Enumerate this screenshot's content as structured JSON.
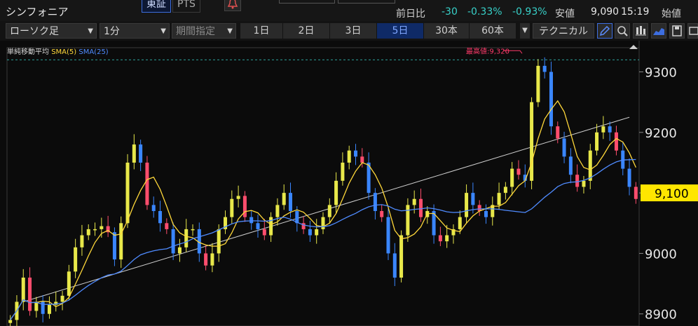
{
  "header": {
    "title": "シンフォニア",
    "exchange_tabs": [
      {
        "label": "東証",
        "active": true
      },
      {
        "label": "PTS",
        "active": false
      }
    ],
    "bell_icon": "bell-icon"
  },
  "quote": {
    "prev_label": "前日比",
    "change": "-30",
    "change_pct": "-0.33%",
    "change_pct2": "-0.93%",
    "low_label": "安値",
    "low_value": "9,090",
    "time": "15:19",
    "open_label": "始値"
  },
  "controls": {
    "chart_type": "ローソク足",
    "interval": "1分",
    "period": "期間指定",
    "ranges": [
      "1日",
      "2日",
      "3日",
      "5日",
      "30本",
      "60本"
    ],
    "selected_range": "5日",
    "technical_label": "テクニカル",
    "icons": [
      "pencil-icon",
      "zoom-icon",
      "volume-icon",
      "area-chart-icon",
      "save-icon",
      "window-icon"
    ]
  },
  "legend": {
    "label": "単純移動平均",
    "sma5": "SMA(5)",
    "sma25": "SMA(25)"
  },
  "colors": {
    "up": "#e8e84a",
    "down": "#3a86ff",
    "sma5": "#ffd83a",
    "sma25": "#4f8bff",
    "accent_positive": "#38d1c9",
    "price_tag": "#ffe600",
    "high_marker": "#ff3a6a"
  },
  "chart_data": {
    "type": "candlestick",
    "y_ticks": [
      8900,
      9000,
      9100,
      9200,
      9300
    ],
    "ylim": [
      8880,
      9340
    ],
    "current_price": "9,100",
    "high_annotation": "最高値:9,320",
    "high_value": 9320,
    "trendline": {
      "from_index": 2,
      "to_index": 95,
      "from_value": 8920,
      "to_value": 9225
    },
    "closes": [
      8890,
      8920,
      8960,
      8905,
      8920,
      8900,
      8915,
      8920,
      8930,
      8970,
      9010,
      9030,
      9040,
      9040,
      9045,
      9035,
      8990,
      9050,
      9150,
      9180,
      9150,
      9080,
      9070,
      9050,
      9040,
      9000,
      9010,
      9040,
      9040,
      9000,
      8980,
      9000,
      9040,
      9060,
      9090,
      9095,
      9060,
      9050,
      9040,
      9030,
      9060,
      9080,
      9100,
      9070,
      9050,
      9040,
      9030,
      9040,
      9060,
      9080,
      9120,
      9150,
      9170,
      9160,
      9150,
      9100,
      9070,
      9060,
      9000,
      8960,
      9030,
      9080,
      9090,
      9060,
      9070,
      9030,
      9020,
      9030,
      9040,
      9060,
      9100,
      9080,
      9070,
      9060,
      9080,
      9100,
      9110,
      9140,
      9130,
      9120,
      9250,
      9310,
      9300,
      9210,
      9190,
      9160,
      9130,
      9110,
      9120,
      9170,
      9200,
      9210,
      9200,
      9170,
      9140,
      9110,
      9090
    ]
  }
}
